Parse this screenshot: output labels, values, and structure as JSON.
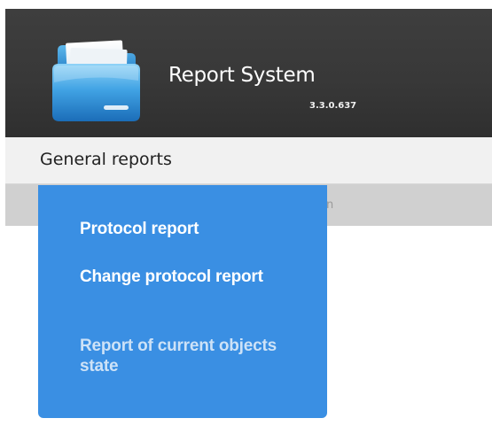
{
  "header": {
    "title": "Report System",
    "version": "3.3.0.637",
    "logo_icon": "folder-icon"
  },
  "nav": {
    "items": [
      {
        "label": "General reports",
        "expanded": true
      }
    ]
  },
  "subbar": {
    "partial_text": "n"
  },
  "dropdown": {
    "items": [
      {
        "label": "Protocol report",
        "enabled": true
      },
      {
        "label": "Change protocol report",
        "enabled": true
      },
      {
        "label": "Report of current objects state",
        "enabled": false
      }
    ]
  },
  "colors": {
    "header_bg": "#383838",
    "navbar_bg": "#f1f1f1",
    "subbar_bg": "#d0d0d0",
    "dropdown_bg": "#3a8fe3",
    "menu_text": "#ffffff",
    "menu_text_disabled": "#cde2f7"
  }
}
